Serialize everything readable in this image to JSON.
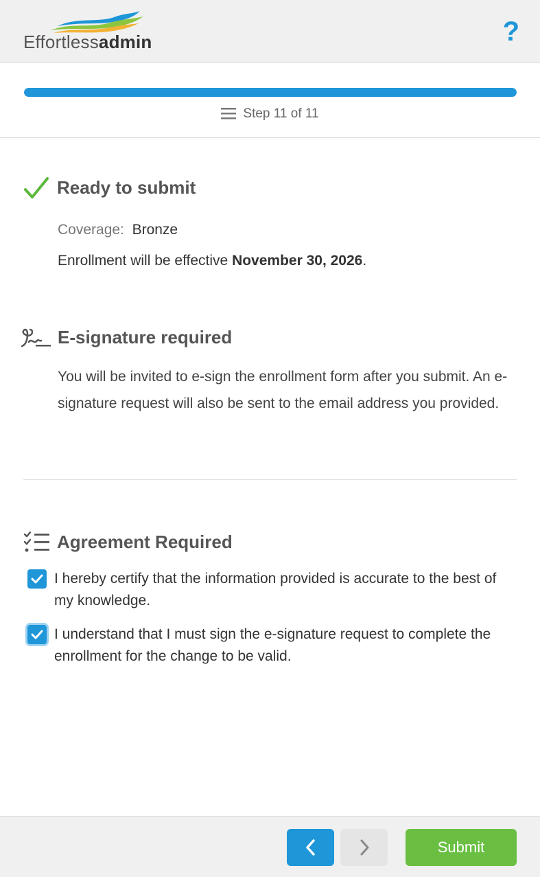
{
  "header": {
    "logo_light": "Effortless",
    "logo_bold": "admin",
    "help_icon": "?"
  },
  "progress": {
    "current_step": 11,
    "total_steps": 11,
    "fraction": 1.0,
    "label": "Step 11 of 11"
  },
  "ready": {
    "title": "Ready to submit",
    "coverage_label": "Coverage:",
    "coverage_value": "Bronze",
    "effective_prefix": "Enrollment will be effective ",
    "effective_date": "November 30, 2026",
    "effective_suffix": "."
  },
  "esign": {
    "title": "E-signature required",
    "body": "You will be invited to e-sign the enrollment form after you submit. An e-signature request will also be sent to the email address you provided."
  },
  "agreement": {
    "title": "Agreement Required",
    "items": [
      {
        "text": "I hereby certify that the information provided is accurate to the best of my knowledge.",
        "checked": true
      },
      {
        "text": "I understand that I must sign the e-signature request to complete the enrollment for the change to be valid.",
        "checked": true
      }
    ]
  },
  "footer": {
    "prev_icon": "chevron-left-icon",
    "next_icon": "chevron-right-icon",
    "submit_label": "Submit"
  },
  "colors": {
    "accent": "#1e96d8",
    "success": "#6abf43",
    "check": "#5cb83c"
  }
}
